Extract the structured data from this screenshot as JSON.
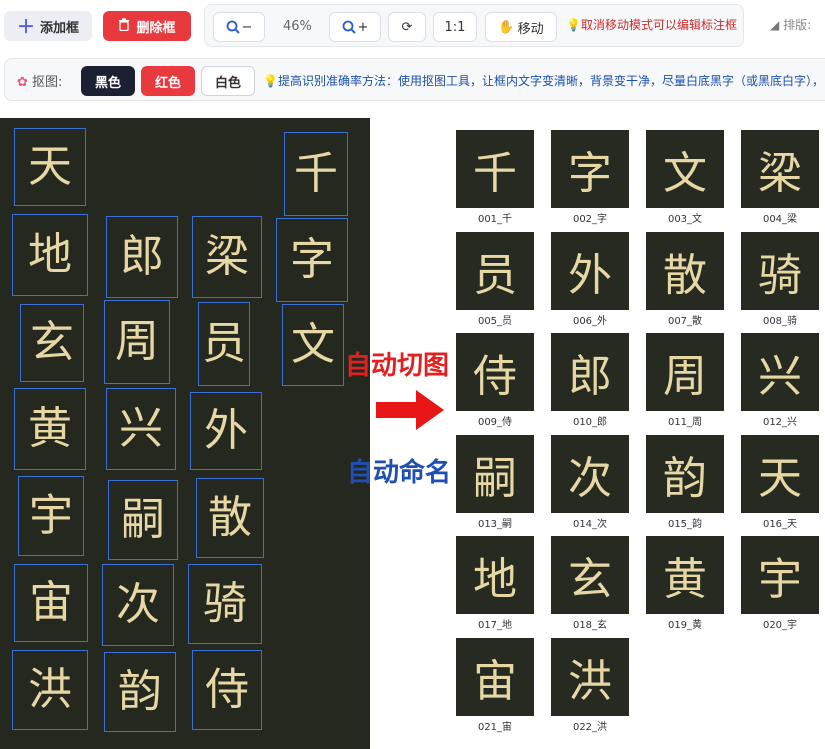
{
  "toolbar": {
    "add_label": "添加框",
    "delete_label": "删除框",
    "zoom_out_label": "−",
    "zoom_level": "46%",
    "zoom_in_label": "+",
    "rotate_label": "⟳",
    "actual_size_label": "1:1",
    "move_label": "移动",
    "move_hint": "取消移动模式可以编辑标注框",
    "layout_label": "排版:"
  },
  "cutout": {
    "label": "抠图:",
    "black_label": "黑色",
    "red_label": "红色",
    "white_label": "白色",
    "hint": "提高识别准确率方法：使用抠图工具，让框内文字变清晰，背景变干净，尽量白底黑字（或黑底白字），"
  },
  "annotations": {
    "auto_cut": "自动切图",
    "auto_name": "自动命名"
  },
  "source_chars": [
    "天",
    "千",
    "地",
    "郎",
    "梁",
    "字",
    "玄",
    "周",
    "员",
    "文",
    "黄",
    "兴",
    "外",
    "宇",
    "嗣",
    "散",
    "宙",
    "次",
    "骑",
    "洪",
    "韵",
    "侍"
  ],
  "thumbnails": [
    {
      "char": "千",
      "caption": "001_千"
    },
    {
      "char": "字",
      "caption": "002_字"
    },
    {
      "char": "文",
      "caption": "003_文"
    },
    {
      "char": "梁",
      "caption": "004_梁"
    },
    {
      "char": "员",
      "caption": "005_员"
    },
    {
      "char": "外",
      "caption": "006_外"
    },
    {
      "char": "散",
      "caption": "007_散"
    },
    {
      "char": "骑",
      "caption": "008_骑"
    },
    {
      "char": "侍",
      "caption": "009_侍"
    },
    {
      "char": "郎",
      "caption": "010_郎"
    },
    {
      "char": "周",
      "caption": "011_周"
    },
    {
      "char": "兴",
      "caption": "012_兴"
    },
    {
      "char": "嗣",
      "caption": "013_嗣"
    },
    {
      "char": "次",
      "caption": "014_次"
    },
    {
      "char": "韵",
      "caption": "015_韵"
    },
    {
      "char": "天",
      "caption": "016_天"
    },
    {
      "char": "地",
      "caption": "017_地"
    },
    {
      "char": "玄",
      "caption": "018_玄"
    },
    {
      "char": "黄",
      "caption": "019_黄"
    },
    {
      "char": "宇",
      "caption": "020_宇"
    },
    {
      "char": "宙",
      "caption": "021_宙"
    },
    {
      "char": "洪",
      "caption": "022_洪"
    }
  ]
}
